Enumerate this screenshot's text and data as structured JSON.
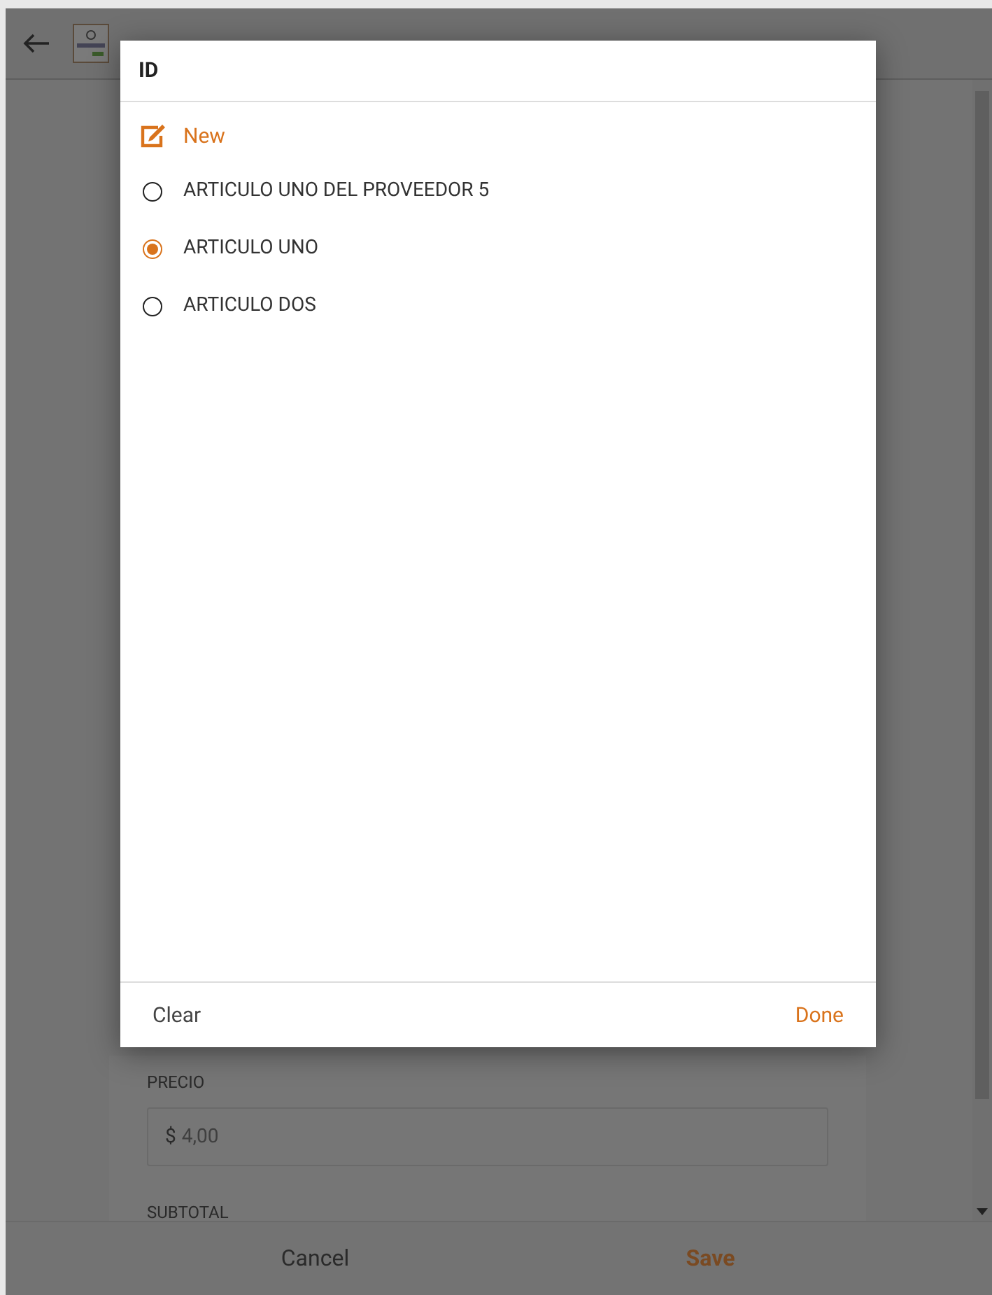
{
  "form": {
    "fields": [
      {
        "label": "PRECIO",
        "prefix": "$",
        "placeholder": "4,00"
      },
      {
        "label": "SUBTOTAL"
      }
    ]
  },
  "bottom_bar": {
    "cancel": "Cancel",
    "save": "Save"
  },
  "dialog": {
    "title": "ID",
    "new_label": "New",
    "options": [
      {
        "label": "ARTICULO UNO DEL PROVEEDOR 5",
        "selected": false
      },
      {
        "label": "ARTICULO UNO",
        "selected": true
      },
      {
        "label": "ARTICULO DOS",
        "selected": false
      }
    ],
    "clear": "Clear",
    "done": "Done"
  }
}
